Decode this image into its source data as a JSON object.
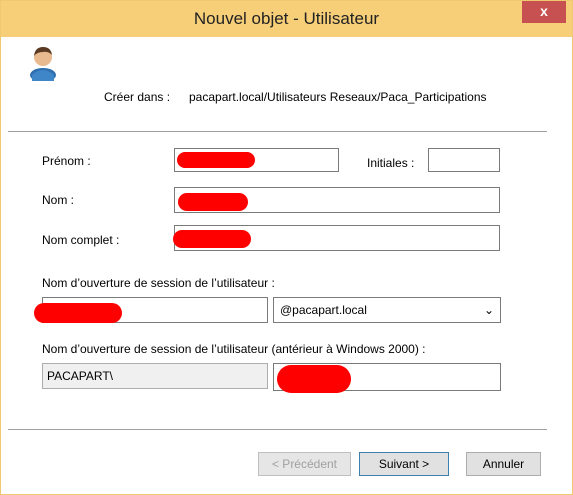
{
  "window": {
    "title": "Nouvel objet - Utilisateur",
    "close_label": "x"
  },
  "header": {
    "icon": "user-icon",
    "create_in_label": "Créer dans :",
    "create_in_path": "pacapart.local/Utilisateurs Reseaux/Paca_Participations"
  },
  "form": {
    "first_name_label": "Prénom :",
    "first_name_value": "",
    "initials_label": "Initiales :",
    "initials_value": "",
    "last_name_label": "Nom :",
    "last_name_value": "",
    "full_name_label": "Nom complet :",
    "full_name_value": "",
    "logon_label": "Nom d’ouverture de session de l’utilisateur :",
    "logon_value": "",
    "logon_domain": "@pacapart.local",
    "pre2000_label": "Nom d’ouverture de session de l’utilisateur (antérieur à Windows 2000) :",
    "pre2000_prefix": "PACAPART\\",
    "pre2000_value": ""
  },
  "buttons": {
    "previous": "< Précédent",
    "next": "Suivant >",
    "cancel": "Annuler"
  },
  "colors": {
    "titlebar": "#f6cf78",
    "close": "#c75050",
    "redaction": "#ff0000"
  }
}
